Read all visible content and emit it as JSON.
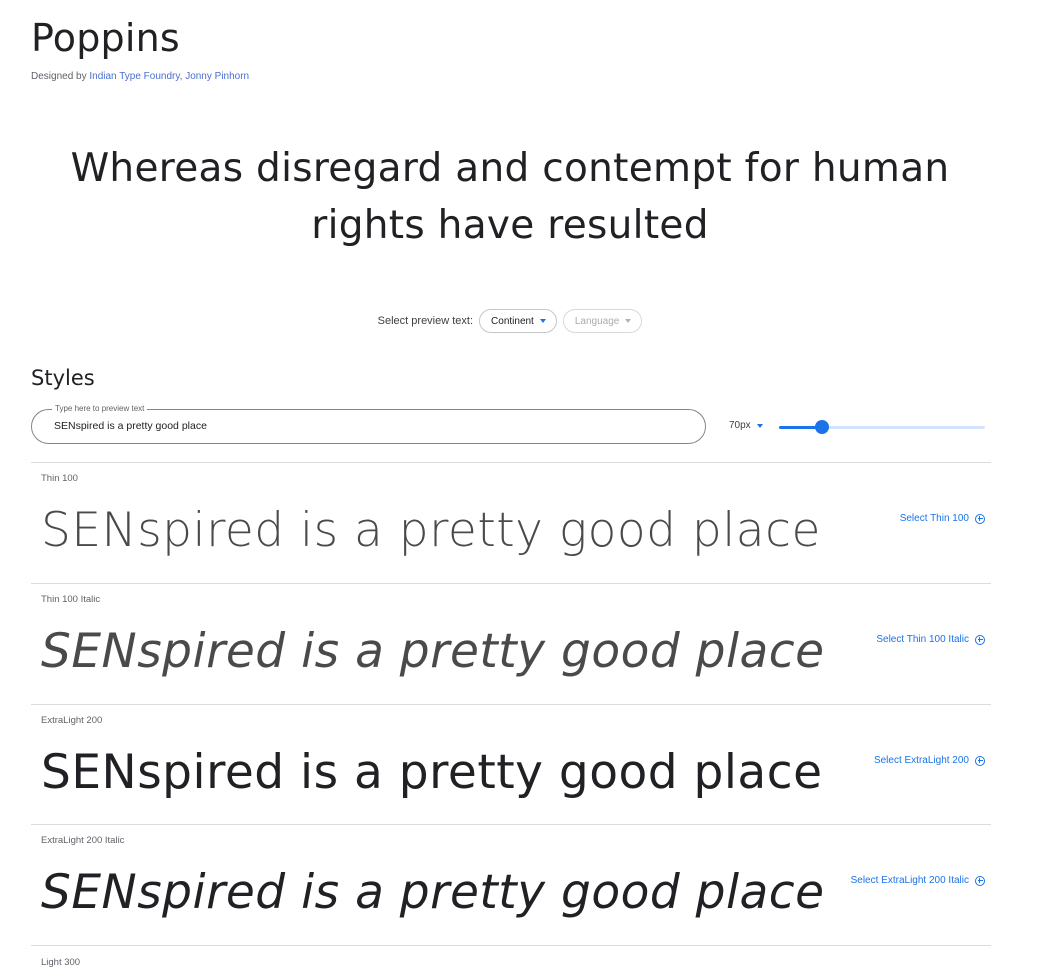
{
  "font": {
    "name": "Poppins",
    "designed_by_prefix": "Designed by ",
    "designers": [
      "Indian Type Foundry",
      "Jonny Pinhorn"
    ],
    "designer_separator": ", "
  },
  "hero": {
    "text": "Whereas disregard and contempt for human rights have resulted"
  },
  "preview_controls": {
    "label": "Select preview text:",
    "continent": "Continent",
    "language": "Language"
  },
  "styles_section": {
    "heading": "Styles",
    "field_label": "Type here to preview text",
    "field_value": "SENspired is a pretty good place",
    "size_label": "70px",
    "size_slider_fraction": 0.21
  },
  "styles": [
    {
      "name": "Thin 100",
      "sample": "SENspired is a pretty good place",
      "select": "Select Thin 100"
    },
    {
      "name": "Thin 100 Italic",
      "sample": "SENspired is a pretty good place",
      "select": "Select Thin 100 Italic"
    },
    {
      "name": "ExtraLight 200",
      "sample": "SENspired is a pretty good place",
      "select": "Select ExtraLight 200"
    },
    {
      "name": "ExtraLight 200 Italic",
      "sample": "SENspired is a pretty good place",
      "select": "Select ExtraLight 200 Italic"
    },
    {
      "name": "Light 300"
    }
  ],
  "colors": {
    "accent": "#1a73e8",
    "link": "#4a6fd1",
    "divider": "#dadce0"
  },
  "icons": {
    "caret": "chevron-down-icon",
    "add": "add-circle-icon"
  }
}
